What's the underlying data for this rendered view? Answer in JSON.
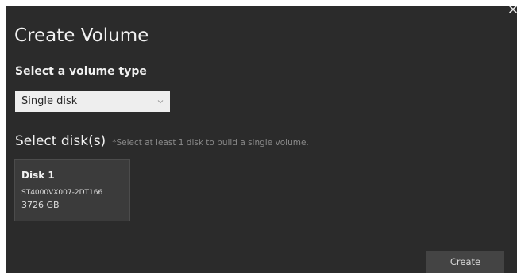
{
  "dialog": {
    "title": "Create Volume",
    "close_icon": "close-icon",
    "volume_type": {
      "label": "Select a volume type",
      "selected": "Single disk",
      "icon": "chevron-down-icon"
    },
    "disks": {
      "title": "Select disk(s)",
      "hint": "*Select at least 1 disk to build a single volume.",
      "items": [
        {
          "name": "Disk 1",
          "model": "ST4000VX007-2DT166",
          "size": "3726 GB"
        }
      ]
    },
    "create_label": "Create"
  },
  "colors": {
    "dialog_background": "#2b2b2b",
    "disk_card_background": "#3b3b3b",
    "button_background": "#444444",
    "select_background": "#eeeeee"
  }
}
